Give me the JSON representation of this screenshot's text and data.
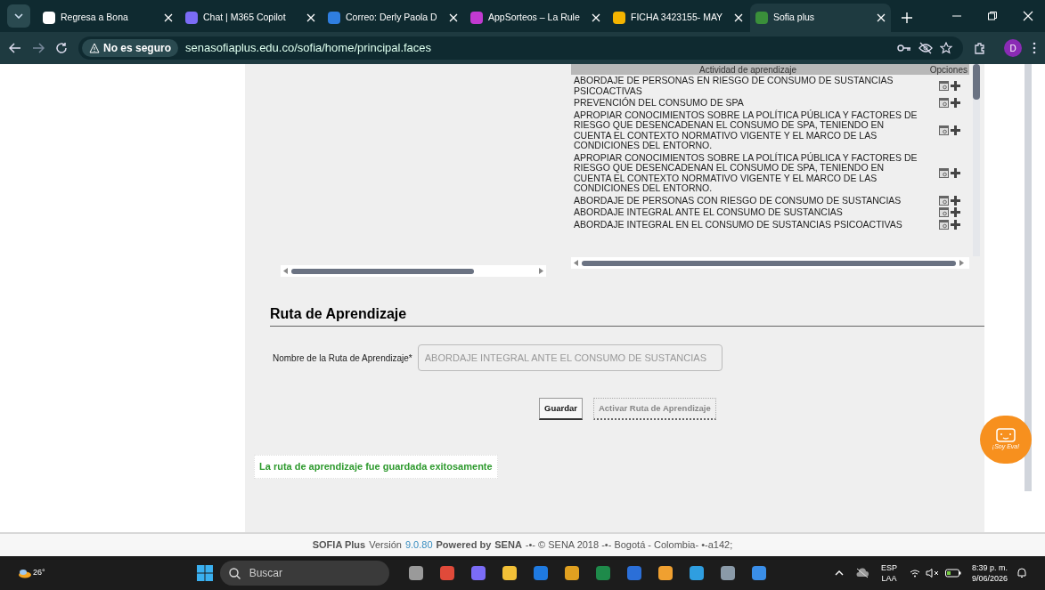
{
  "browser": {
    "tabs": [
      {
        "title": "Regresa a Bona",
        "selected": false,
        "color": "#ffffff"
      },
      {
        "title": "Chat | M365 Copilot",
        "selected": false,
        "color": "#7b6cf6"
      },
      {
        "title": "Correo: Derly Paola D",
        "selected": false,
        "color": "#2f7ee0"
      },
      {
        "title": "AppSorteos – La Rule",
        "selected": false,
        "color": "#c13ad1"
      },
      {
        "title": "FICHA 3423155- MAY",
        "selected": false,
        "color": "#f4b400"
      },
      {
        "title": "Sofia plus",
        "selected": true,
        "color": "#3a8f3a"
      }
    ],
    "security": "No es seguro",
    "url": "senasofiaplus.edu.co/sofia/home/principal.faces",
    "profile": "D"
  },
  "activities_table": {
    "columns": [
      "Actividad de aprendizaje",
      "Opciones"
    ],
    "rows": [
      "ABORDAJE DE PERSONAS EN RIESGO DE CONSUMO DE SUSTANCIAS PSICOACTIVAS",
      "PREVENCIÓN DEL CONSUMO DE SPA",
      "APROPIAR CONOCIMIENTOS SOBRE LA POLÍTICA PÚBLICA Y FACTORES DE RIESGO QUE DESENCADENAN EL CONSUMO DE SPA, TENIENDO EN CUENTA EL CONTEXTO NORMATIVO VIGENTE Y EL MARCO DE LAS CONDICIONES DEL ENTORNO.",
      "APROPIAR CONOCIMIENTOS SOBRE LA POLÍTICA PÚBLICA Y FACTORES DE RIESGO QUE DESENCADENAN EL CONSUMO DE SPA, TENIENDO EN CUENTA EL CONTEXTO NORMATIVO VIGENTE Y EL MARCO DE LAS CONDICIONES DEL ENTORNO.",
      "ABORDAJE DE PERSONAS CON RIESGO DE CONSUMO DE SUSTANCIAS",
      "ABORDAJE INTEGRAL ANTE EL CONSUMO DE SUSTANCIAS",
      "ABORDAJE INTEGRAL EN EL CONSUMO DE SUSTANCIAS PSICOACTIVAS"
    ]
  },
  "route": {
    "heading": "Ruta de Aprendizaje",
    "field_label": "Nombre de la Ruta de Aprendizaje*",
    "field_value": "ABORDAJE INTEGRAL ANTE EL CONSUMO DE SUSTANCIAS",
    "buttons": [
      {
        "label": "Guardar",
        "disabled": false
      },
      {
        "label": "Activar Ruta de Aprendizaje",
        "disabled": true
      }
    ],
    "message": "La ruta de aprendizaje fue guardada exitosamente"
  },
  "assistant": {
    "label": "¡Soy Eva!"
  },
  "footer": [
    {
      "text": "SOFIA Plus",
      "kind": "bold"
    },
    {
      "text": "Versión",
      "kind": "plain"
    },
    {
      "text": "9.0.80",
      "kind": "link"
    },
    {
      "text": "Powered by",
      "kind": "bold"
    },
    {
      "text": "SENA",
      "kind": "bold"
    },
    {
      "text": "-•- © SENA 2018 -•- Bogotá - Colombia- •-a142;",
      "kind": "plain"
    }
  ],
  "taskbar": {
    "weather": "26°",
    "search_placeholder": "Buscar",
    "language": "ESP",
    "layout": "LAA",
    "time": "8:39 p. m.",
    "date": "9/06/2026"
  }
}
